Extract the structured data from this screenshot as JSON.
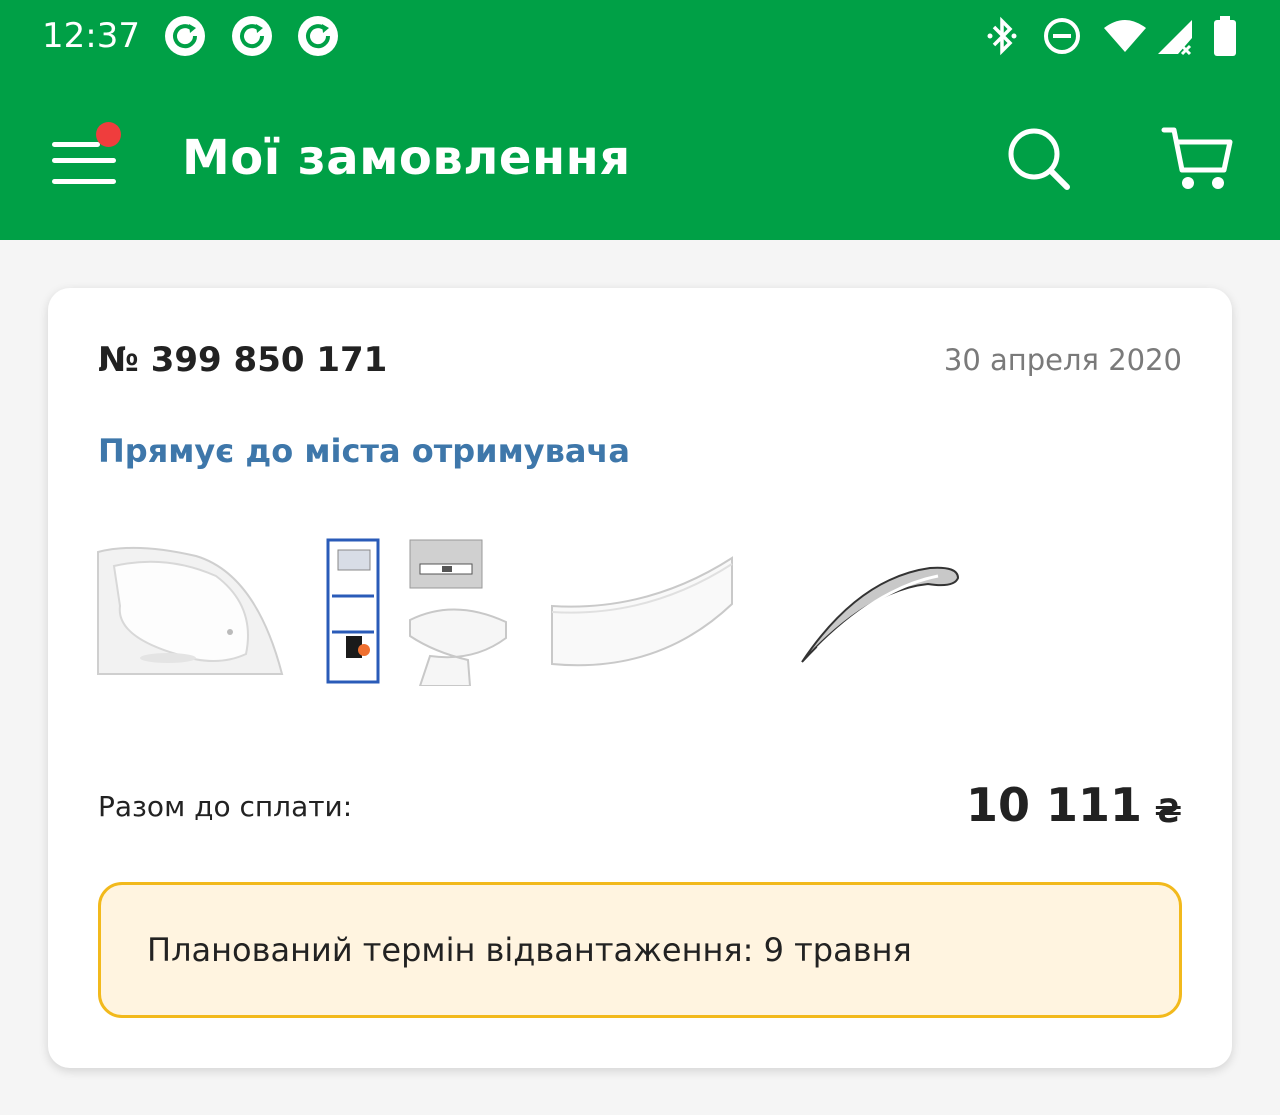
{
  "status_bar": {
    "time": "12:37",
    "notification_icons": [
      "sync-icon",
      "sync-icon",
      "sync-icon"
    ],
    "system_icons": [
      "bluetooth-icon",
      "do-not-disturb-icon",
      "wifi-icon",
      "cellular-signal-icon",
      "battery-icon"
    ]
  },
  "app_bar": {
    "title": "Мої замовлення",
    "menu_icon": "hamburger-menu-icon",
    "menu_badge": true,
    "actions": [
      "search-icon",
      "cart-icon"
    ],
    "background_color": "#00a046"
  },
  "order": {
    "number": "№ 399 850 171",
    "date": "30 апреля 2020",
    "status": "Прямує до міста отримувача",
    "status_color": "#3e77aa",
    "items": [
      "corner-bathtub-image",
      "installation-set-image",
      "bath-panel-image",
      "bath-handle-image"
    ],
    "total_label": "Разом до сплати:",
    "total_amount": "10 111",
    "currency": "₴",
    "notice": "Планований термін відвантаження: 9 травня",
    "notice_border_color": "#f2b91c",
    "notice_bg_color": "#fff4e0"
  }
}
